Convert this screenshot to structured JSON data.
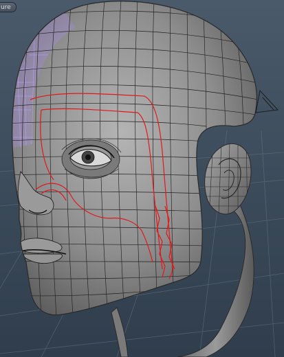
{
  "viewport": {
    "tab_label": "ure"
  },
  "scene": {
    "object": "head-mesh",
    "colors": {
      "background_top": "#4a5a6a",
      "background_bottom": "#2f3d4c",
      "mesh_fill": "#8c8c8c",
      "wire": "#1e1e1e",
      "selection_edges": "#e01818",
      "selected_faces": "#a78be0"
    }
  }
}
